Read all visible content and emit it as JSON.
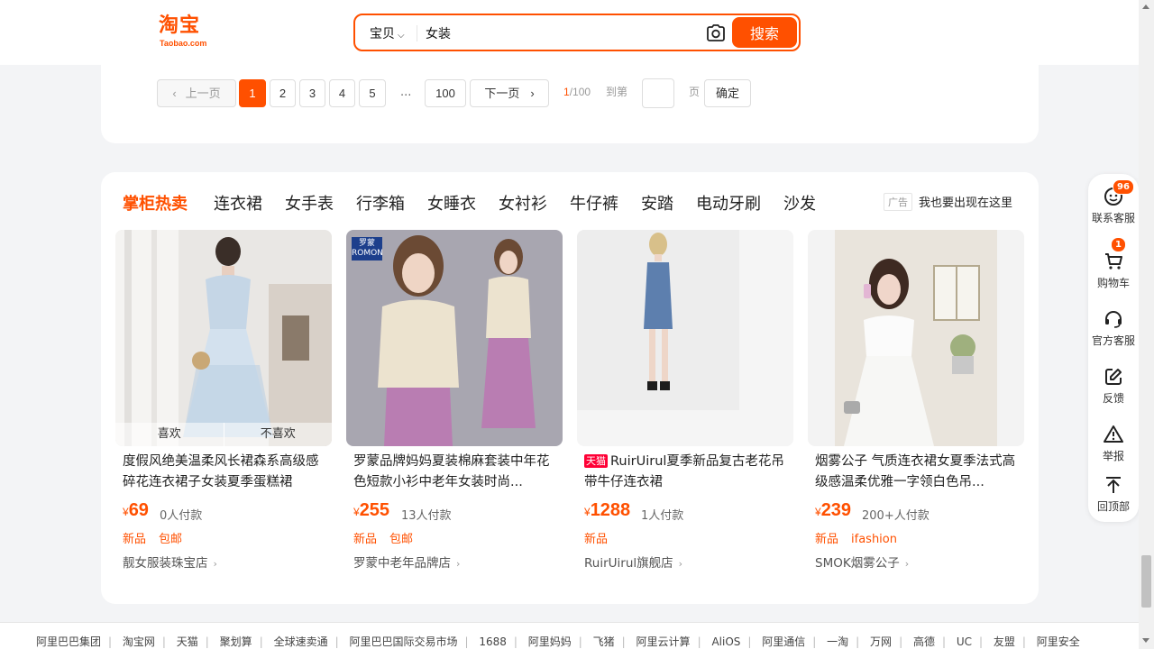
{
  "header": {
    "logo_cn": "淘宝",
    "logo_en": "Taobao.com",
    "search_category": "宝贝",
    "search_value": "女装",
    "search_button": "搜索"
  },
  "pagination": {
    "prev": "上一页",
    "pages": [
      "1",
      "2",
      "3",
      "4",
      "5"
    ],
    "ellipsis": "...",
    "last": "100",
    "next": "下一页",
    "current": "1",
    "total_label": "/100",
    "goto_label": "到第",
    "page_label": "页",
    "confirm": "确定"
  },
  "hot": {
    "title": "掌柜热卖",
    "tabs": [
      "连衣裙",
      "女手表",
      "行李箱",
      "女睡衣",
      "女衬衫",
      "牛仔裤",
      "安踏",
      "电动牙刷",
      "沙发"
    ],
    "ad_badge": "广告",
    "ad_link": "我也要出现在这里",
    "like": "喜欢",
    "dislike": "不喜欢",
    "products": [
      {
        "title": "度假风绝美温柔风长裙森系高级感碎花连衣裙子女装夏季蛋糕裙",
        "currency": "¥",
        "price": "69",
        "sales": "0人付款",
        "tags": [
          "新品",
          "包邮"
        ],
        "shop": "靓女服装珠宝店"
      },
      {
        "title": "罗蒙品牌妈妈夏装棉麻套装中年花色短款小衫中老年女装时尚...",
        "badge": "罗蒙 ROMON",
        "currency": "¥",
        "price": "255",
        "sales": "13人付款",
        "tags": [
          "新品",
          "包邮"
        ],
        "shop": "罗蒙中老年品牌店"
      },
      {
        "title_badge": "天猫",
        "title": "RuirUirul夏季新品复古老花吊带牛仔连衣裙",
        "currency": "¥",
        "price": "1288",
        "sales": "1人付款",
        "tags": [
          "新品"
        ],
        "shop": "RuirUirul旗舰店"
      },
      {
        "title": "烟雾公子 气质连衣裙女夏季法式高级感温柔优雅一字领白色吊...",
        "currency": "¥",
        "price": "239",
        "sales": "200+人付款",
        "tags": [
          "新品",
          "ifashion"
        ],
        "shop": "SMOK烟雾公子"
      }
    ]
  },
  "sidebar": {
    "items": [
      {
        "label": "联系客服",
        "badge": "96"
      },
      {
        "label": "购物车",
        "badge": "1"
      },
      {
        "label": "官方客服"
      },
      {
        "label": "反馈"
      },
      {
        "label": "举报"
      },
      {
        "label": "回顶部"
      }
    ]
  },
  "footer": {
    "links": [
      "阿里巴巴集团",
      "淘宝网",
      "天猫",
      "聚划算",
      "全球速卖通",
      "阿里巴巴国际交易市场",
      "1688",
      "阿里妈妈",
      "飞猪",
      "阿里云计算",
      "AliOS",
      "阿里通信",
      "一淘",
      "万网",
      "高德",
      "UC",
      "友盟",
      "阿里安全"
    ]
  },
  "colors": {
    "accent": "#ff5000",
    "tmall": "#ff0036"
  }
}
